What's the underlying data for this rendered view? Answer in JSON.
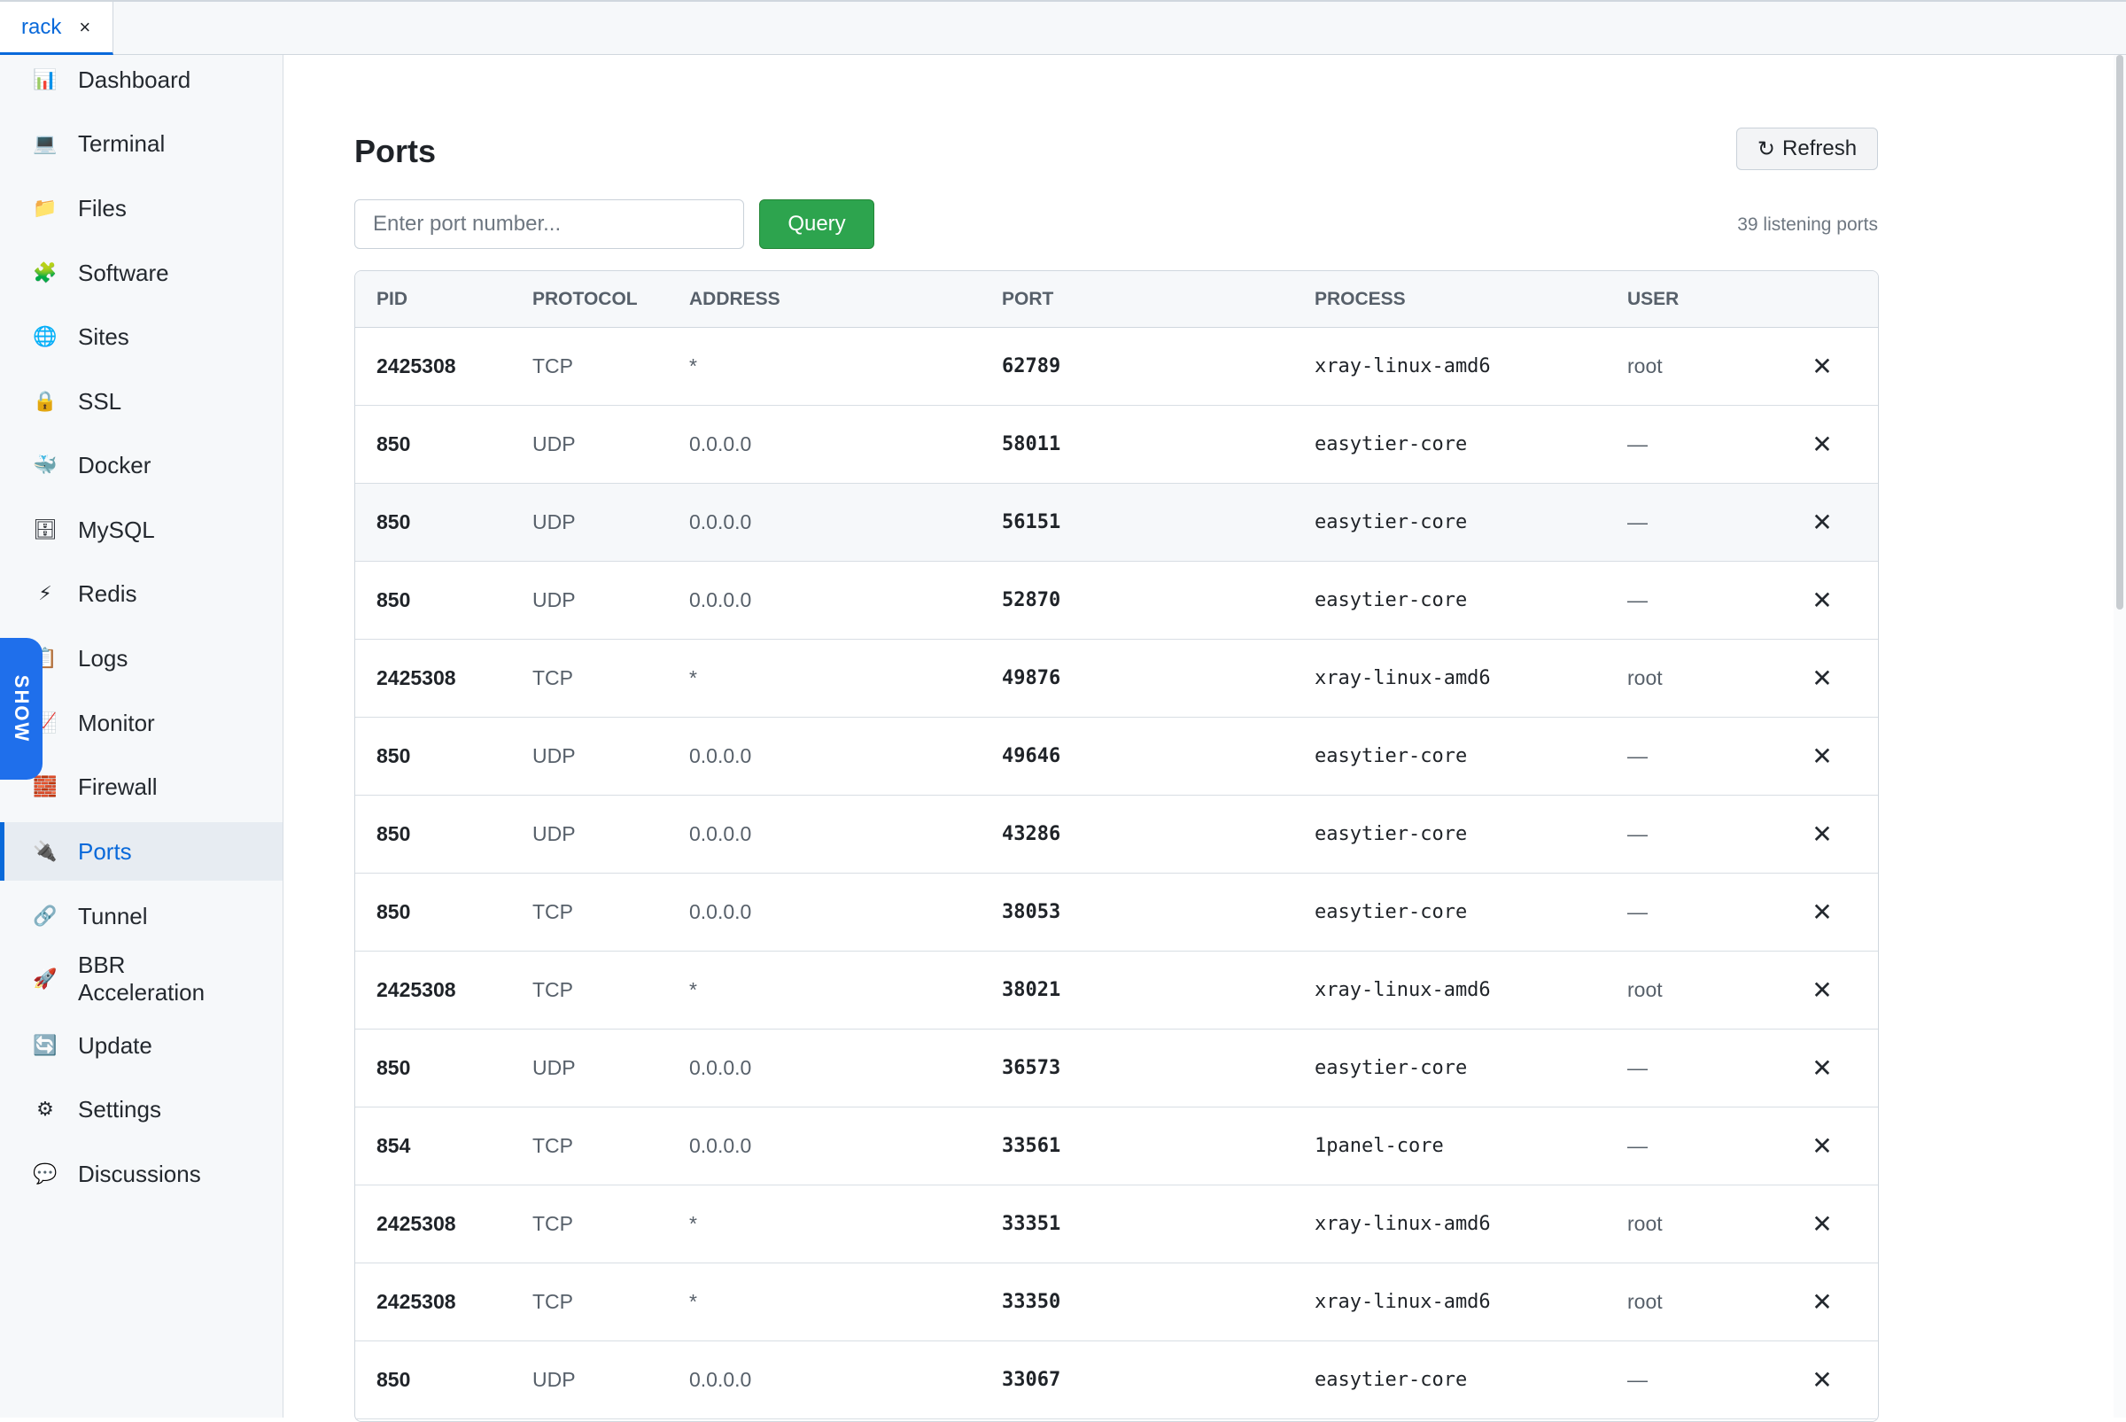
{
  "tab": {
    "title": "rack",
    "close": "×"
  },
  "sidebar": {
    "items": [
      {
        "label": "Dashboard",
        "icon": "📊",
        "icon_name": "dashboard-icon"
      },
      {
        "label": "Terminal",
        "icon": "💻",
        "icon_name": "terminal-icon"
      },
      {
        "label": "Files",
        "icon": "📁",
        "icon_name": "folder-icon"
      },
      {
        "label": "Software",
        "icon": "🧩",
        "icon_name": "puzzle-icon"
      },
      {
        "label": "Sites",
        "icon": "🌐",
        "icon_name": "globe-icon"
      },
      {
        "label": "SSL",
        "icon": "🔒",
        "icon_name": "lock-icon"
      },
      {
        "label": "Docker",
        "icon": "🐳",
        "icon_name": "whale-icon"
      },
      {
        "label": "MySQL",
        "icon": "🗄",
        "icon_name": "database-icon"
      },
      {
        "label": "Redis",
        "icon": "⚡",
        "icon_name": "lightning-icon"
      },
      {
        "label": "Logs",
        "icon": "📋",
        "icon_name": "clipboard-icon"
      },
      {
        "label": "Monitor",
        "icon": "📈",
        "icon_name": "chart-icon"
      },
      {
        "label": "Firewall",
        "icon": "🧱",
        "icon_name": "brick-wall-icon"
      },
      {
        "label": "Ports",
        "icon": "🔌",
        "icon_name": "plug-icon",
        "active": true
      },
      {
        "label": "Tunnel",
        "icon": "🔗",
        "icon_name": "link-icon"
      },
      {
        "label": "BBR\nAcceleration",
        "icon": "🚀",
        "icon_name": "rocket-icon"
      },
      {
        "label": "Update",
        "icon": "🔄",
        "icon_name": "refresh-cycle-icon"
      },
      {
        "label": "Settings",
        "icon": "⚙",
        "icon_name": "gear-icon"
      },
      {
        "label": "Discussions",
        "icon": "💬",
        "icon_name": "speech-bubble-icon"
      }
    ],
    "show_toggle": "SHOW"
  },
  "header": {
    "title": "Ports",
    "refresh_label": "Refresh",
    "refresh_icon": "↻"
  },
  "search": {
    "placeholder": "Enter port number...",
    "value": "",
    "query_label": "Query",
    "count_text": "39 listening ports"
  },
  "table": {
    "columns": [
      "PID",
      "PROTOCOL",
      "ADDRESS",
      "PORT",
      "PROCESS",
      "USER"
    ],
    "rows": [
      {
        "pid": "2425308",
        "protocol": "TCP",
        "address": "*",
        "port": "62789",
        "process": "xray-linux-amd6",
        "user": "root"
      },
      {
        "pid": "850",
        "protocol": "UDP",
        "address": "0.0.0.0",
        "port": "58011",
        "process": "easytier-core",
        "user": "—"
      },
      {
        "pid": "850",
        "protocol": "UDP",
        "address": "0.0.0.0",
        "port": "56151",
        "process": "easytier-core",
        "user": "—"
      },
      {
        "pid": "850",
        "protocol": "UDP",
        "address": "0.0.0.0",
        "port": "52870",
        "process": "easytier-core",
        "user": "—"
      },
      {
        "pid": "2425308",
        "protocol": "TCP",
        "address": "*",
        "port": "49876",
        "process": "xray-linux-amd6",
        "user": "root"
      },
      {
        "pid": "850",
        "protocol": "UDP",
        "address": "0.0.0.0",
        "port": "49646",
        "process": "easytier-core",
        "user": "—"
      },
      {
        "pid": "850",
        "protocol": "UDP",
        "address": "0.0.0.0",
        "port": "43286",
        "process": "easytier-core",
        "user": "—"
      },
      {
        "pid": "850",
        "protocol": "TCP",
        "address": "0.0.0.0",
        "port": "38053",
        "process": "easytier-core",
        "user": "—"
      },
      {
        "pid": "2425308",
        "protocol": "TCP",
        "address": "*",
        "port": "38021",
        "process": "xray-linux-amd6",
        "user": "root"
      },
      {
        "pid": "850",
        "protocol": "UDP",
        "address": "0.0.0.0",
        "port": "36573",
        "process": "easytier-core",
        "user": "—"
      },
      {
        "pid": "854",
        "protocol": "TCP",
        "address": "0.0.0.0",
        "port": "33561",
        "process": "1panel-core",
        "user": "—"
      },
      {
        "pid": "2425308",
        "protocol": "TCP",
        "address": "*",
        "port": "33351",
        "process": "xray-linux-amd6",
        "user": "root"
      },
      {
        "pid": "2425308",
        "protocol": "TCP",
        "address": "*",
        "port": "33350",
        "process": "xray-linux-amd6",
        "user": "root"
      },
      {
        "pid": "850",
        "protocol": "UDP",
        "address": "0.0.0.0",
        "port": "33067",
        "process": "easytier-core",
        "user": "—"
      }
    ],
    "kill_icon": "✕",
    "hovered_row": 2
  },
  "colors": {
    "accent": "#0969da",
    "query_green": "#2da44e",
    "show_blue": "#1f6feb"
  }
}
